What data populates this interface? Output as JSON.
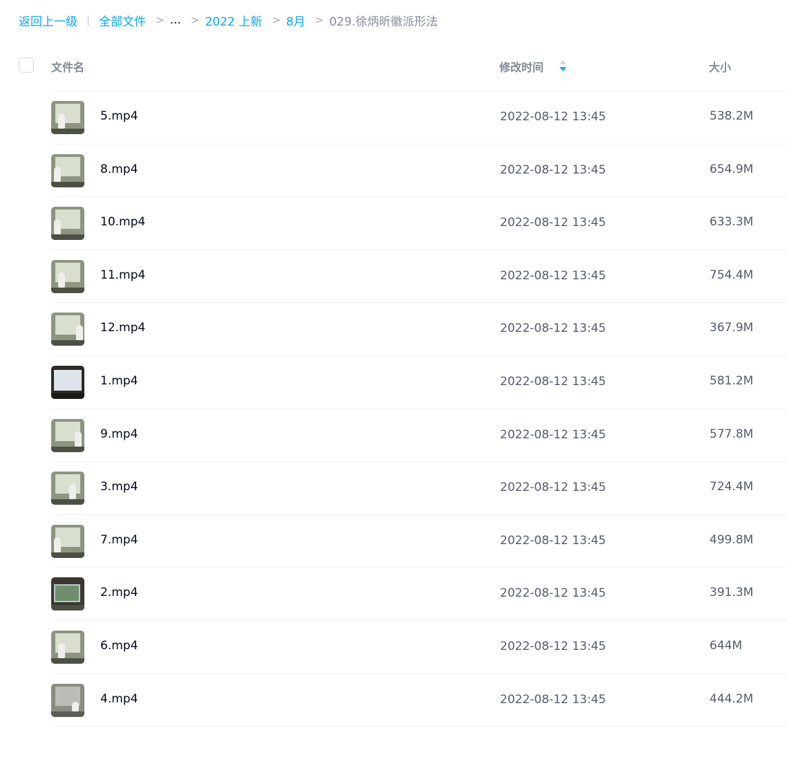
{
  "breadcrumb": {
    "back": "返回上一级",
    "sep_bar": "|",
    "root": "全部文件",
    "ellipsis": "...",
    "level1": "2022 上新",
    "level2": "8月",
    "current": "029.徐炳昕徽派形法",
    "arrow": ">"
  },
  "header": {
    "name": "文件名",
    "time": "修改时间",
    "size": "大小",
    "sort_icon": "sort-updown-icon"
  },
  "thumbnail_icon": "video-thumbnail",
  "files": [
    {
      "name": "5.mp4",
      "time": "2022-08-12 13:45",
      "size": "538.2M"
    },
    {
      "name": "8.mp4",
      "time": "2022-08-12 13:45",
      "size": "654.9M"
    },
    {
      "name": "10.mp4",
      "time": "2022-08-12 13:45",
      "size": "633.3M"
    },
    {
      "name": "11.mp4",
      "time": "2022-08-12 13:45",
      "size": "754.4M"
    },
    {
      "name": "12.mp4",
      "time": "2022-08-12 13:45",
      "size": "367.9M"
    },
    {
      "name": "1.mp4",
      "time": "2022-08-12 13:45",
      "size": "581.2M"
    },
    {
      "name": "9.mp4",
      "time": "2022-08-12 13:45",
      "size": "577.8M"
    },
    {
      "name": "3.mp4",
      "time": "2022-08-12 13:45",
      "size": "724.4M"
    },
    {
      "name": "7.mp4",
      "time": "2022-08-12 13:45",
      "size": "499.8M"
    },
    {
      "name": "2.mp4",
      "time": "2022-08-12 13:45",
      "size": "391.3M"
    },
    {
      "name": "6.mp4",
      "time": "2022-08-12 13:45",
      "size": "644M"
    },
    {
      "name": "4.mp4",
      "time": "2022-08-12 13:45",
      "size": "444.2M"
    }
  ],
  "colors": {
    "link": "#06a7ff",
    "header_text": "#818999",
    "body_text": "#03081a",
    "meta_text": "#555b6b",
    "divider": "#f1f2f4"
  }
}
